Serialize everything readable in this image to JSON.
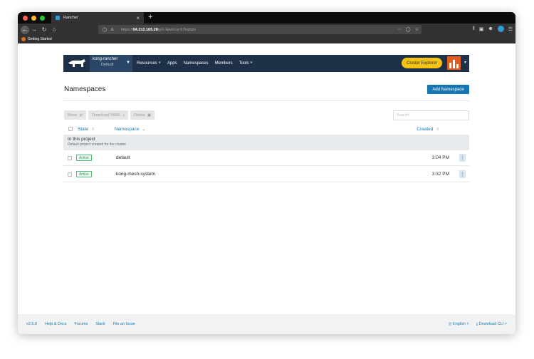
{
  "browser": {
    "tab_title": "Rancher",
    "tab_close": "×",
    "new_tab": "+",
    "url_protocol": "https://",
    "url_host": "54.212.165.28",
    "url_path": "/p/c-kpwnt:p-57bqbjzs",
    "bookmark": "Getting Started"
  },
  "header": {
    "cluster_name": "kong-rancher",
    "project_name": "Default",
    "nav": [
      "Resources",
      "Apps",
      "Namespaces",
      "Members",
      "Tools"
    ],
    "explorer_label": "Cluster Explorer"
  },
  "page": {
    "title": "Namespaces",
    "add_button": "Add Namespace"
  },
  "toolbar": {
    "move_label": "Move",
    "download_label": "Download YAML",
    "delete_label": "Delete",
    "search_placeholder": "Search"
  },
  "table": {
    "columns": {
      "state": "State",
      "namespace": "Namespace",
      "created": "Created"
    },
    "group": {
      "title": "In this project",
      "subtitle": "Default project created for the cluster"
    },
    "rows": [
      {
        "state": "Active",
        "name": "default",
        "created": "3:04 PM"
      },
      {
        "state": "Active",
        "name": "kong-mesh-system",
        "created": "3:32 PM"
      }
    ]
  },
  "footer": {
    "version": "v2.5.8",
    "help": "Help & Docs",
    "forums": "Forums",
    "slack": "Slack",
    "issue": "File an Issue",
    "language": "English",
    "download_cli": "Download CLI"
  },
  "colors": {
    "header_bg": "#1e3148",
    "accent": "#1877b3",
    "explorer_button": "#f5c313",
    "active_badge": "#53b87a"
  }
}
